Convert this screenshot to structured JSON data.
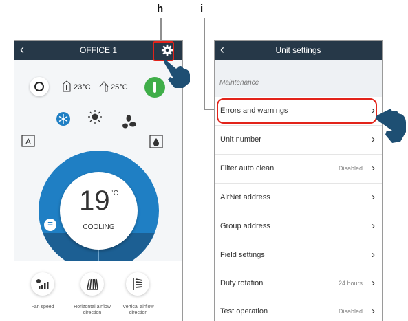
{
  "callouts": {
    "h": "h",
    "i": "i"
  },
  "left_screen": {
    "header": {
      "back_icon": "‹",
      "title": "OFFICE 1"
    },
    "indoor_temp": "23°C",
    "outdoor_temp": "25°C",
    "setpoint": {
      "value": "19",
      "unit": "°C",
      "mode": "COOLING"
    },
    "adjust": {
      "minus": "−",
      "plus": "+"
    },
    "mode_icons": [
      "auto-icon",
      "cool-snowflake-icon",
      "heat-sun-icon",
      "fan-icon",
      "dry-icon"
    ],
    "bottom": [
      {
        "icon": "fan-speed-icon",
        "label": "Fan speed"
      },
      {
        "icon": "horizontal-airflow-icon",
        "label": "Horizontal airflow direction"
      },
      {
        "icon": "vertical-airflow-icon",
        "label": "Vertical airflow direction"
      }
    ]
  },
  "right_screen": {
    "header": {
      "back_icon": "‹",
      "title": "Unit settings"
    },
    "section": "Maintenance",
    "rows": [
      {
        "label": "Errors and warnings",
        "value": ""
      },
      {
        "label": "Unit number",
        "value": ""
      },
      {
        "label": "Filter auto clean",
        "value": "Disabled"
      },
      {
        "label": "AirNet address",
        "value": ""
      },
      {
        "label": "Group address",
        "value": ""
      },
      {
        "label": "Field settings",
        "value": ""
      },
      {
        "label": "Duty rotation",
        "value": "24 hours"
      },
      {
        "label": "Test operation",
        "value": "Disabled"
      }
    ]
  },
  "colors": {
    "header": "#263848",
    "accent_blue": "#1f7fc4",
    "power_green": "#3fae49",
    "highlight_red": "#e2231a",
    "hand": "#1e4f73"
  }
}
